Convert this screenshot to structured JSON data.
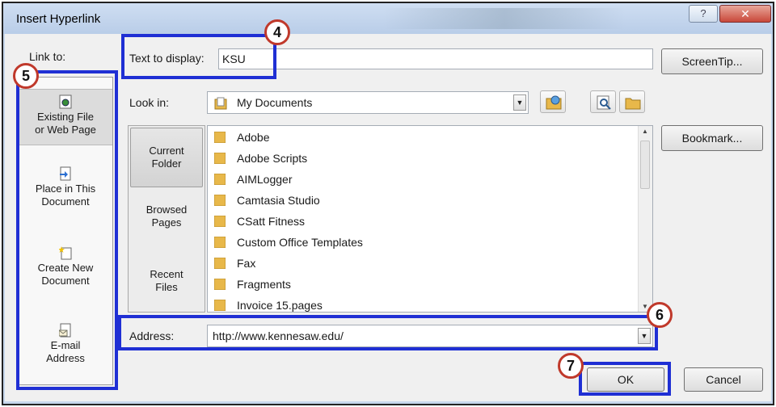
{
  "window": {
    "title": "Insert Hyperlink",
    "help_glyph": "?",
    "close_glyph": "✕"
  },
  "link_to": {
    "label": "Link to:",
    "items": [
      {
        "line1": "Existing File",
        "line2": "or Web Page",
        "icon": "web-page-icon",
        "selected": true
      },
      {
        "line1": "Place in This",
        "line2": "Document",
        "icon": "document-place-icon",
        "selected": false
      },
      {
        "line1": "Create New",
        "line2": "Document",
        "icon": "new-document-icon",
        "selected": false
      },
      {
        "line1": "E-mail",
        "line2": "Address",
        "icon": "email-icon",
        "selected": false
      }
    ]
  },
  "text_to_display": {
    "label": "Text to display:",
    "value": "KSU"
  },
  "look_in": {
    "label": "Look in:",
    "value": "My Documents"
  },
  "nav": {
    "items": [
      {
        "line1": "Current",
        "line2": "Folder",
        "selected": true
      },
      {
        "line1": "Browsed",
        "line2": "Pages",
        "selected": false
      },
      {
        "line1": "Recent",
        "line2": "Files",
        "selected": false
      }
    ]
  },
  "files": [
    "Adobe",
    "Adobe Scripts",
    "AIMLogger",
    "Camtasia Studio",
    "CSatt Fitness",
    "Custom Office Templates",
    "Fax",
    "Fragments",
    "Invoice 15.pages"
  ],
  "address": {
    "label": "Address:",
    "value": "http://www.kennesaw.edu/"
  },
  "buttons": {
    "screentip": "ScreenTip...",
    "bookmark": "Bookmark...",
    "ok": "OK",
    "cancel": "Cancel"
  },
  "callouts": {
    "c4": "4",
    "c5": "5",
    "c6": "6",
    "c7": "7"
  },
  "colors": {
    "highlight": "#1f2fd4",
    "callout_ring": "#c0392b",
    "folder": "#e8b84a"
  }
}
